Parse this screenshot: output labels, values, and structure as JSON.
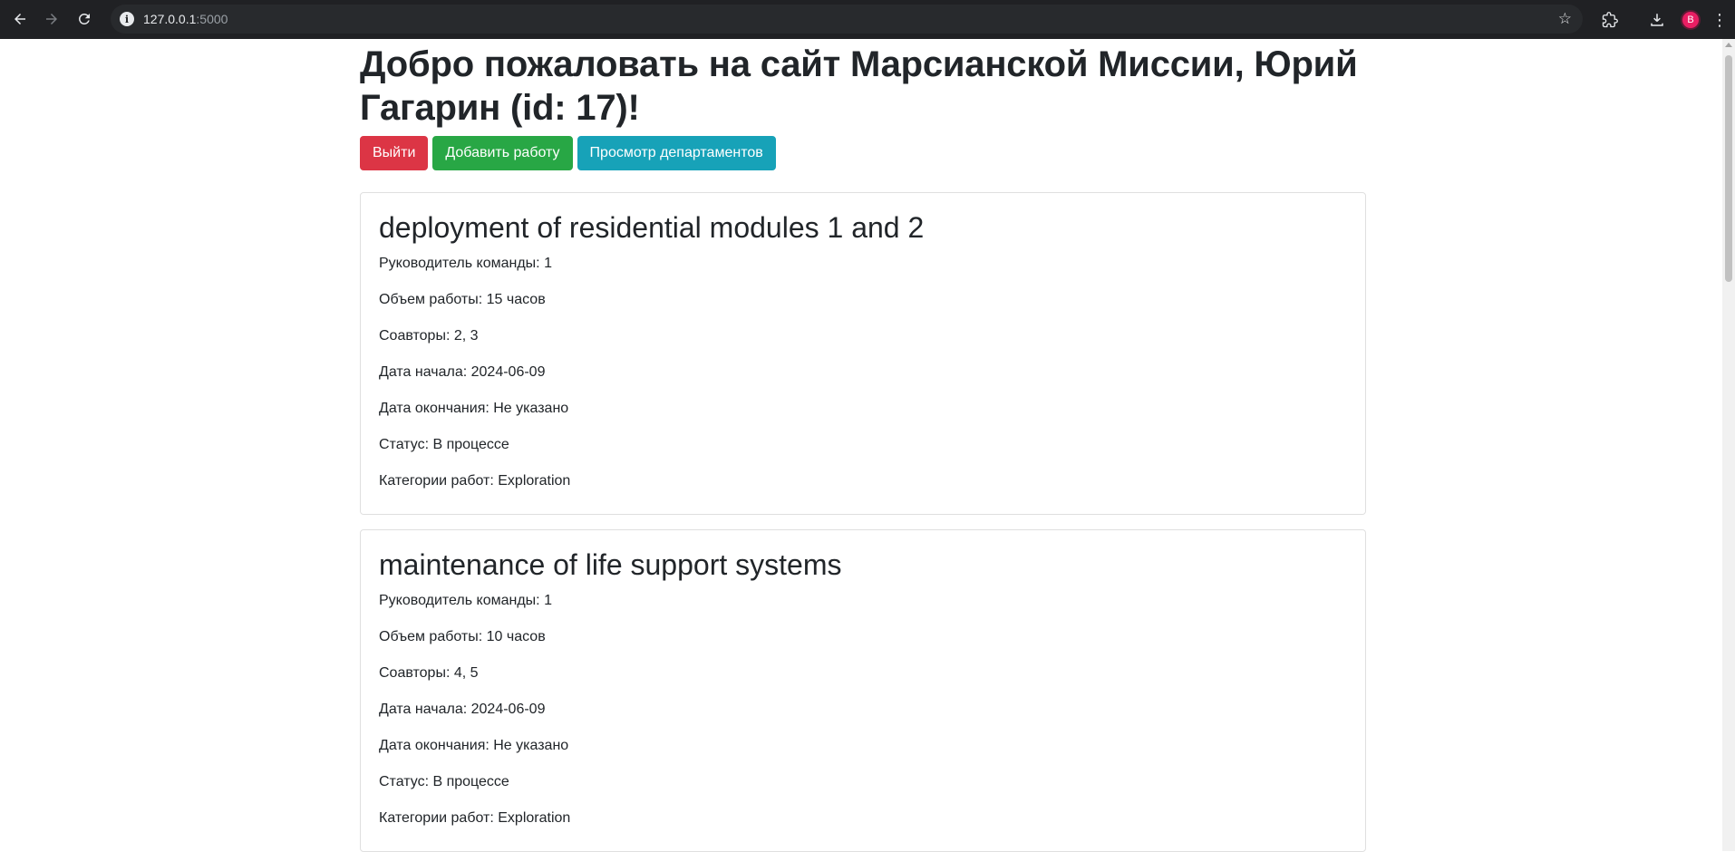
{
  "browser": {
    "url_host": "127.0.0.1",
    "url_port": ":5000",
    "profile_initial": "B"
  },
  "page": {
    "welcome": "Добро пожаловать на сайт Марсианской Миссии, Юрий Гагарин (id: 17)!",
    "buttons": {
      "logout": "Выйти",
      "add_job": "Добавить работу",
      "departments": "Просмотр департаментов"
    }
  },
  "jobs": [
    {
      "title": "deployment of residential modules 1 and 2",
      "leader": "Руководитель команды: 1",
      "work_size": "Объем работы: 15 часов",
      "collaborators": "Соавторы: 2, 3",
      "start_date": "Дата начала: 2024-06-09",
      "end_date": "Дата окончания: Не указано",
      "status": "Статус: В процессе",
      "categories": "Категории работ: Exploration"
    },
    {
      "title": "maintenance of life support systems",
      "leader": "Руководитель команды: 1",
      "work_size": "Объем работы: 10 часов",
      "collaborators": "Соавторы: 4, 5",
      "start_date": "Дата начала: 2024-06-09",
      "end_date": "Дата окончания: Не указано",
      "status": "Статус: В процессе",
      "categories": "Категории работ: Exploration"
    }
  ],
  "colors": {
    "danger": "#dc3545",
    "success": "#28a745",
    "info": "#17a2b8",
    "chrome": "#202124"
  }
}
